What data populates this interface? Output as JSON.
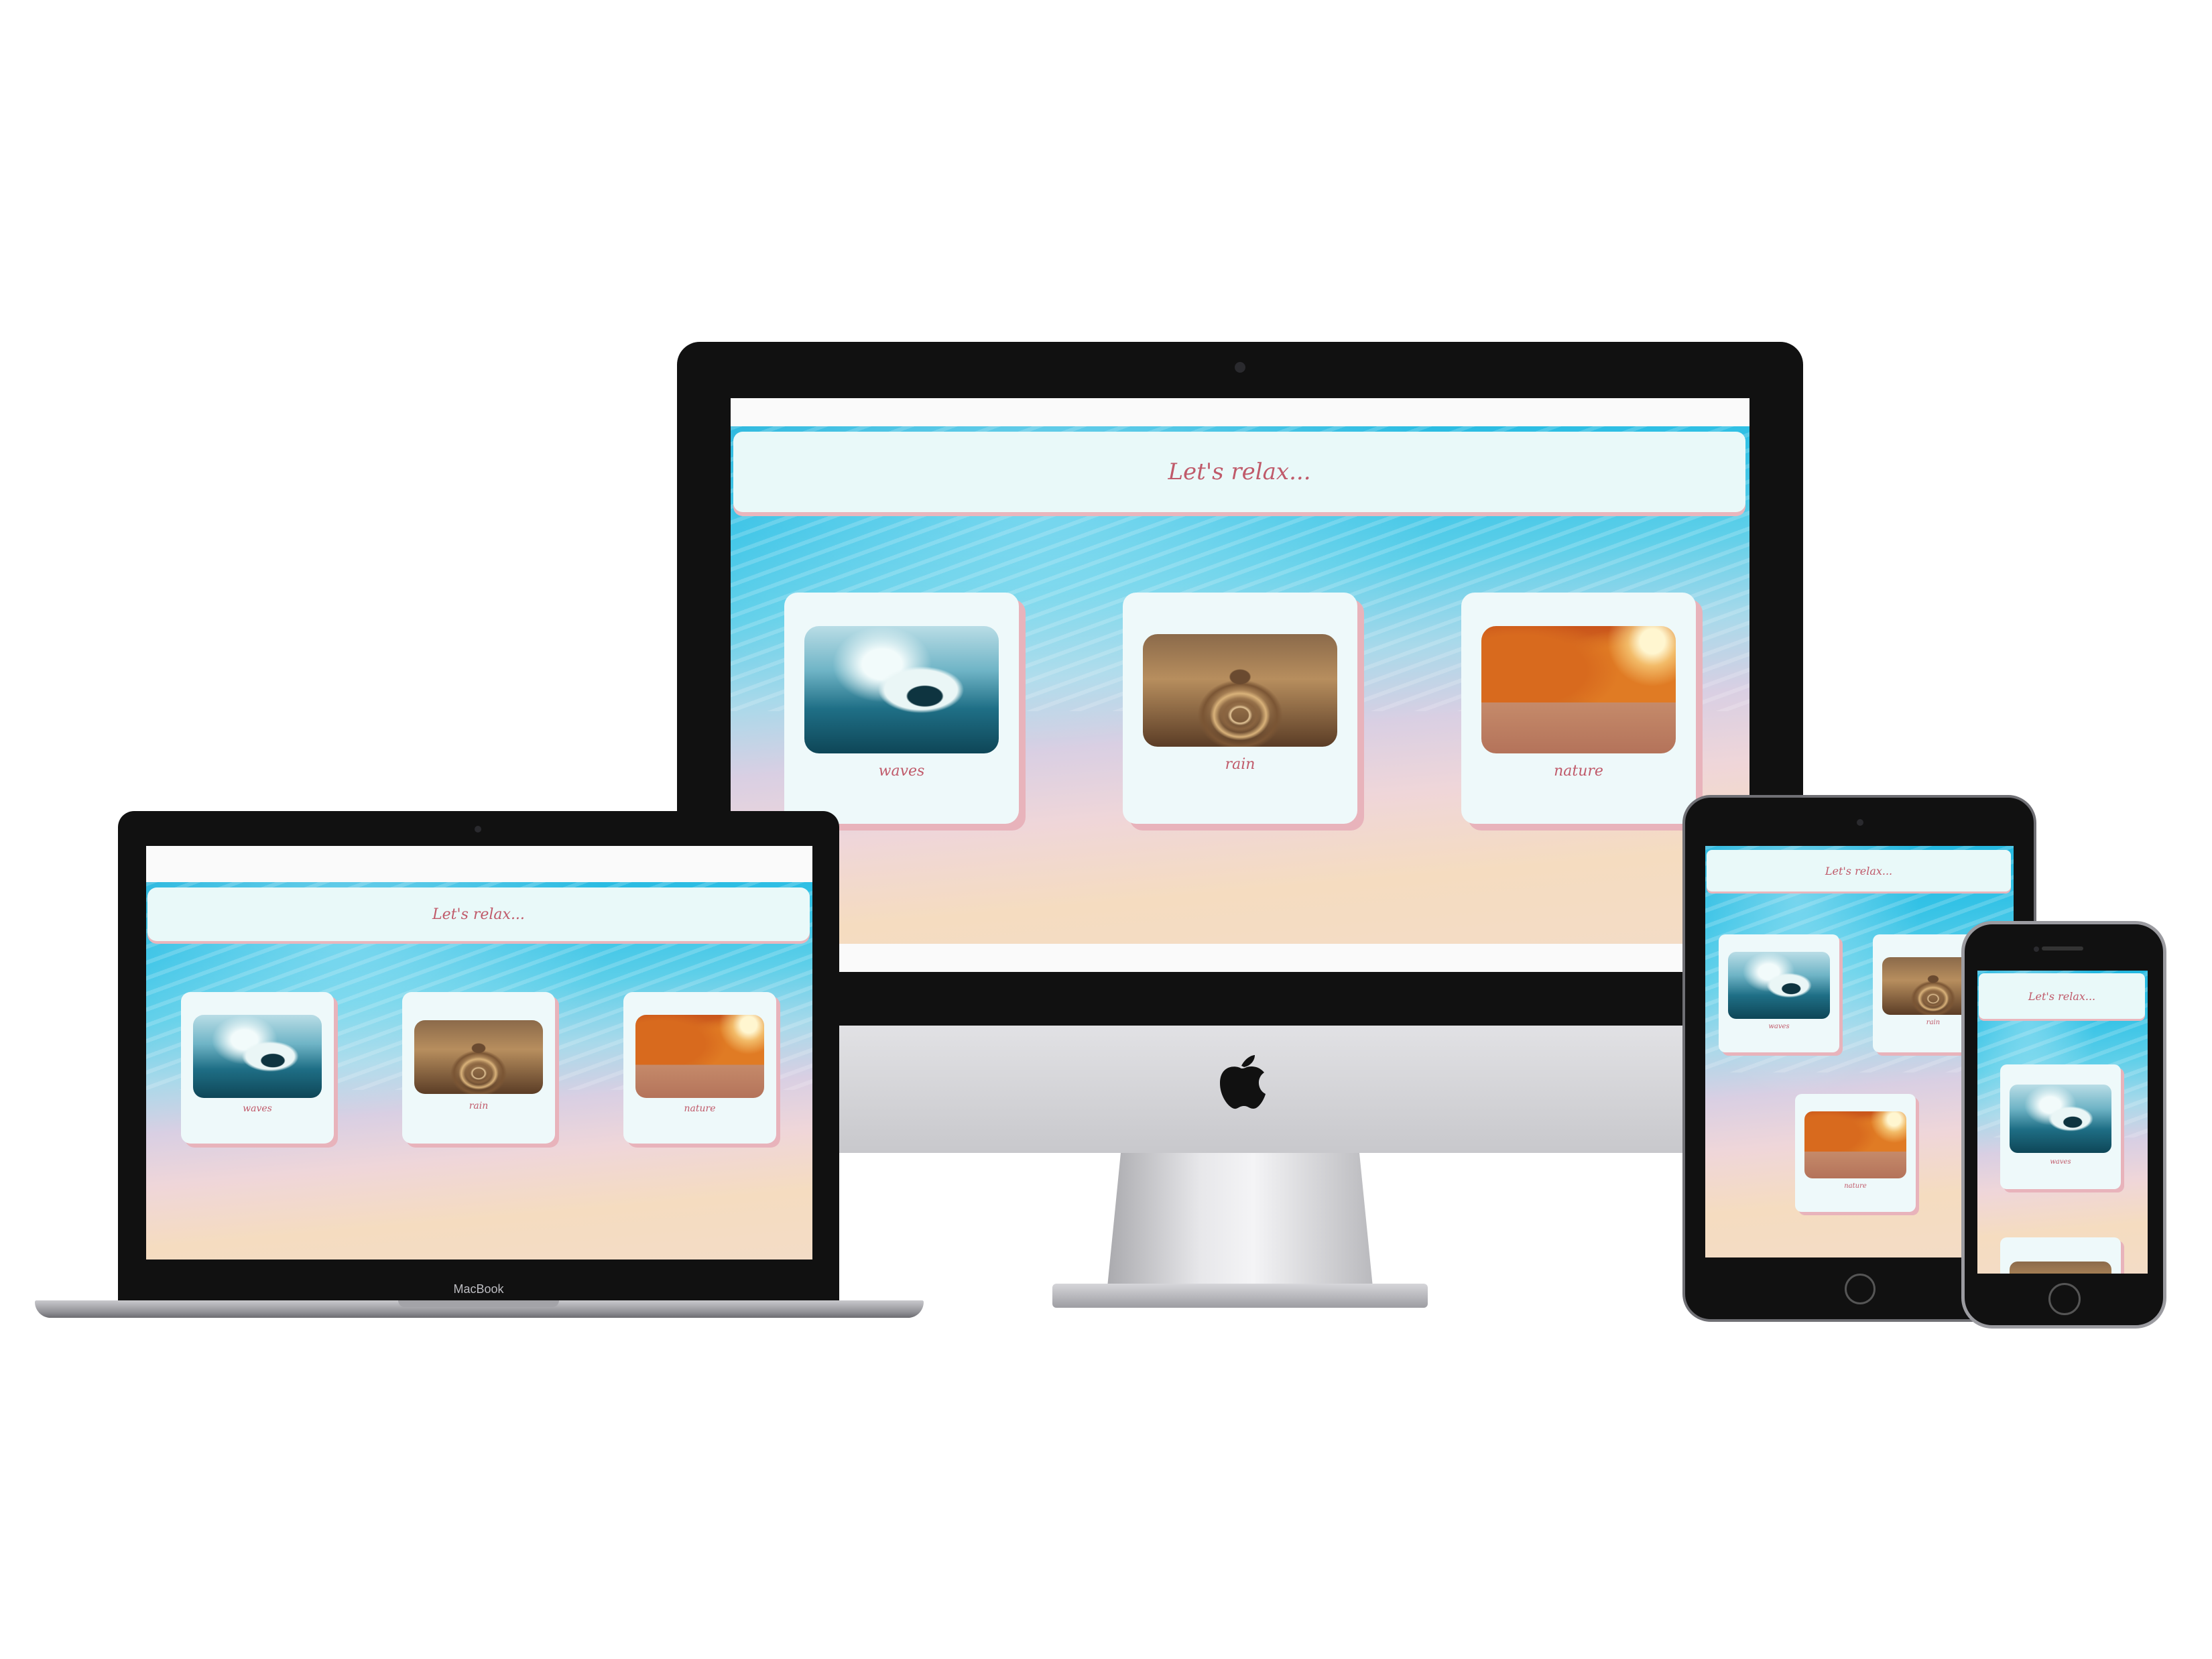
{
  "app": {
    "header_title": "Let's relax...",
    "cards": [
      {
        "label": "waves",
        "image": "ocean-wave-photo"
      },
      {
        "label": "rain",
        "image": "water-drop-photo"
      },
      {
        "label": "nature",
        "image": "autumn-forest-photo"
      }
    ]
  },
  "devices": {
    "laptop_brand": "MacBook",
    "desktop_logo": "apple-logo"
  },
  "colors": {
    "header_bg": "#e9f9f9",
    "title_text": "#c05a6a",
    "card_shadow": "#e8b3bb",
    "ocean": "#1fb4dd",
    "sand": "#f5dcc0"
  }
}
